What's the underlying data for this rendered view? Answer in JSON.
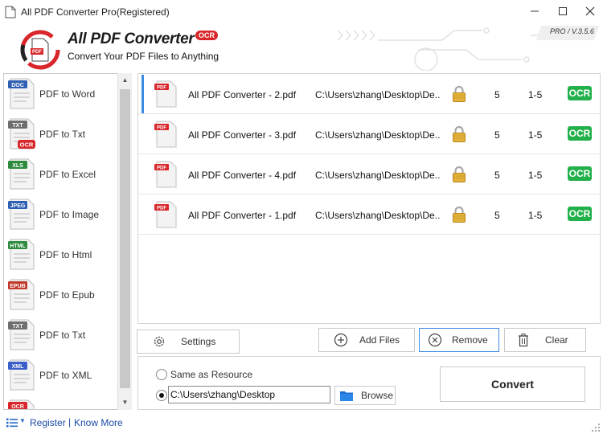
{
  "window": {
    "title": "All PDF Converter Pro(Registered)"
  },
  "header": {
    "app_name": "All PDF Converter",
    "ocr_tag": "OCR",
    "tagline": "Convert Your PDF Files to Anything",
    "version": "PRO / V.3.5.6"
  },
  "formats": [
    {
      "label": "PDF to Word",
      "tag": "DOC",
      "tag_color": "#2f5fb3",
      "icon": "word-doc-icon"
    },
    {
      "label": "PDF to Txt",
      "tag": "TXT",
      "tag_color": "#6e6e6e",
      "icon": "txt-ocr-icon",
      "ocr": "OCR"
    },
    {
      "label": "PDF to Excel",
      "tag": "XLS",
      "tag_color": "#2e8b3e",
      "icon": "excel-icon"
    },
    {
      "label": "PDF to Image",
      "tag": "JPEG",
      "tag_color": "#2f5fb3",
      "icon": "image-icon"
    },
    {
      "label": "PDF to Html",
      "tag": "HTML",
      "tag_color": "#2e8b3e",
      "icon": "html-icon"
    },
    {
      "label": "PDF to Epub",
      "tag": "EPUB",
      "tag_color": "#c0392b",
      "icon": "epub-icon"
    },
    {
      "label": "PDF to Txt",
      "tag": "TXT",
      "tag_color": "#6e6e6e",
      "icon": "txt-icon"
    },
    {
      "label": "PDF to XML",
      "tag": "XML",
      "tag_color": "#3a5fc8",
      "icon": "xml-icon"
    },
    {
      "label": "",
      "tag": "OCR",
      "tag_color": "#d8262a",
      "icon": "ocr-icon"
    }
  ],
  "files": [
    {
      "name": "All PDF Converter - 2.pdf",
      "path": "C:\\Users\\zhang\\Desktop\\De...",
      "pages": "5",
      "range": "1-5",
      "ocr": "OCR",
      "selected": true
    },
    {
      "name": "All PDF Converter - 3.pdf",
      "path": "C:\\Users\\zhang\\Desktop\\De...",
      "pages": "5",
      "range": "1-5",
      "ocr": "OCR",
      "selected": false
    },
    {
      "name": "All PDF Converter - 4.pdf",
      "path": "C:\\Users\\zhang\\Desktop\\De...",
      "pages": "5",
      "range": "1-5",
      "ocr": "OCR",
      "selected": false
    },
    {
      "name": "All PDF Converter - 1.pdf",
      "path": "C:\\Users\\zhang\\Desktop\\De...",
      "pages": "5",
      "range": "1-5",
      "ocr": "OCR",
      "selected": false
    }
  ],
  "toolbar": {
    "settings": "Settings",
    "add_files": "Add Files",
    "remove": "Remove",
    "clear": "Clear"
  },
  "output": {
    "same_as_resource": "Same as Resource",
    "path_value": "C:\\Users\\zhang\\Desktop",
    "browse": "Browse",
    "convert": "Convert"
  },
  "footer": {
    "register": "Register",
    "separator": "|",
    "know_more": "Know More"
  },
  "colors": {
    "accent_blue": "#3b8be0",
    "ocr_green": "#22b04a",
    "brand_red": "#d8262a",
    "link_blue": "#1a4aa8"
  }
}
